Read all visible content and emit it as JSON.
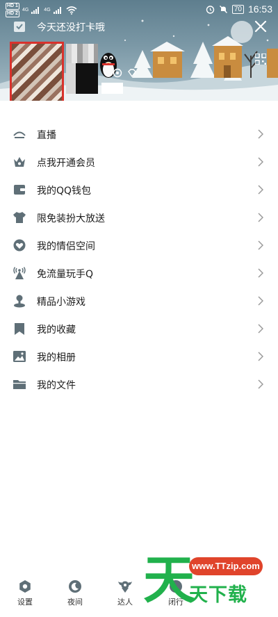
{
  "status_bar": {
    "sim_tags": [
      "HD 1",
      "HD 2"
    ],
    "network": [
      "4G",
      "4G"
    ],
    "battery": "70",
    "time": "16:53"
  },
  "header": {
    "checkin_text": "今天还没打卡哦",
    "icons": [
      "checkin-icon",
      "close-icon",
      "qr-code-icon",
      "penguin-icon"
    ]
  },
  "menu": {
    "items": [
      {
        "label": "直播",
        "icon": "live-icon"
      },
      {
        "label": "点我开通会员",
        "icon": "vip-crown-icon"
      },
      {
        "label": "我的QQ钱包",
        "icon": "wallet-icon"
      },
      {
        "label": "限免装扮大放送",
        "icon": "shirt-icon"
      },
      {
        "label": "我的情侣空间",
        "icon": "hearts-icon"
      },
      {
        "label": "免流量玩手Q",
        "icon": "signal-tower-icon"
      },
      {
        "label": "精品小游戏",
        "icon": "game-pin-icon"
      },
      {
        "label": "我的收藏",
        "icon": "bookmark-icon"
      },
      {
        "label": "我的相册",
        "icon": "photo-icon"
      },
      {
        "label": "我的文件",
        "icon": "folder-icon"
      }
    ]
  },
  "bottom_bar": {
    "items": [
      {
        "label": "设置",
        "icon": "settings-icon"
      },
      {
        "label": "夜间",
        "icon": "night-mode-icon"
      },
      {
        "label": "达人",
        "icon": "expert-badge-icon"
      },
      {
        "label": "闭行",
        "icon": "stealth-icon"
      }
    ]
  },
  "watermark": {
    "url": "www.TTzip.com",
    "big_char": "天",
    "small_text": "天下载"
  },
  "colors": {
    "icon_gray": "#5f6f77",
    "chevron": "#9a9a9a",
    "avatar_border": "#d9322c",
    "watermark_green": "#21b14c",
    "watermark_red": "#e0442b"
  }
}
